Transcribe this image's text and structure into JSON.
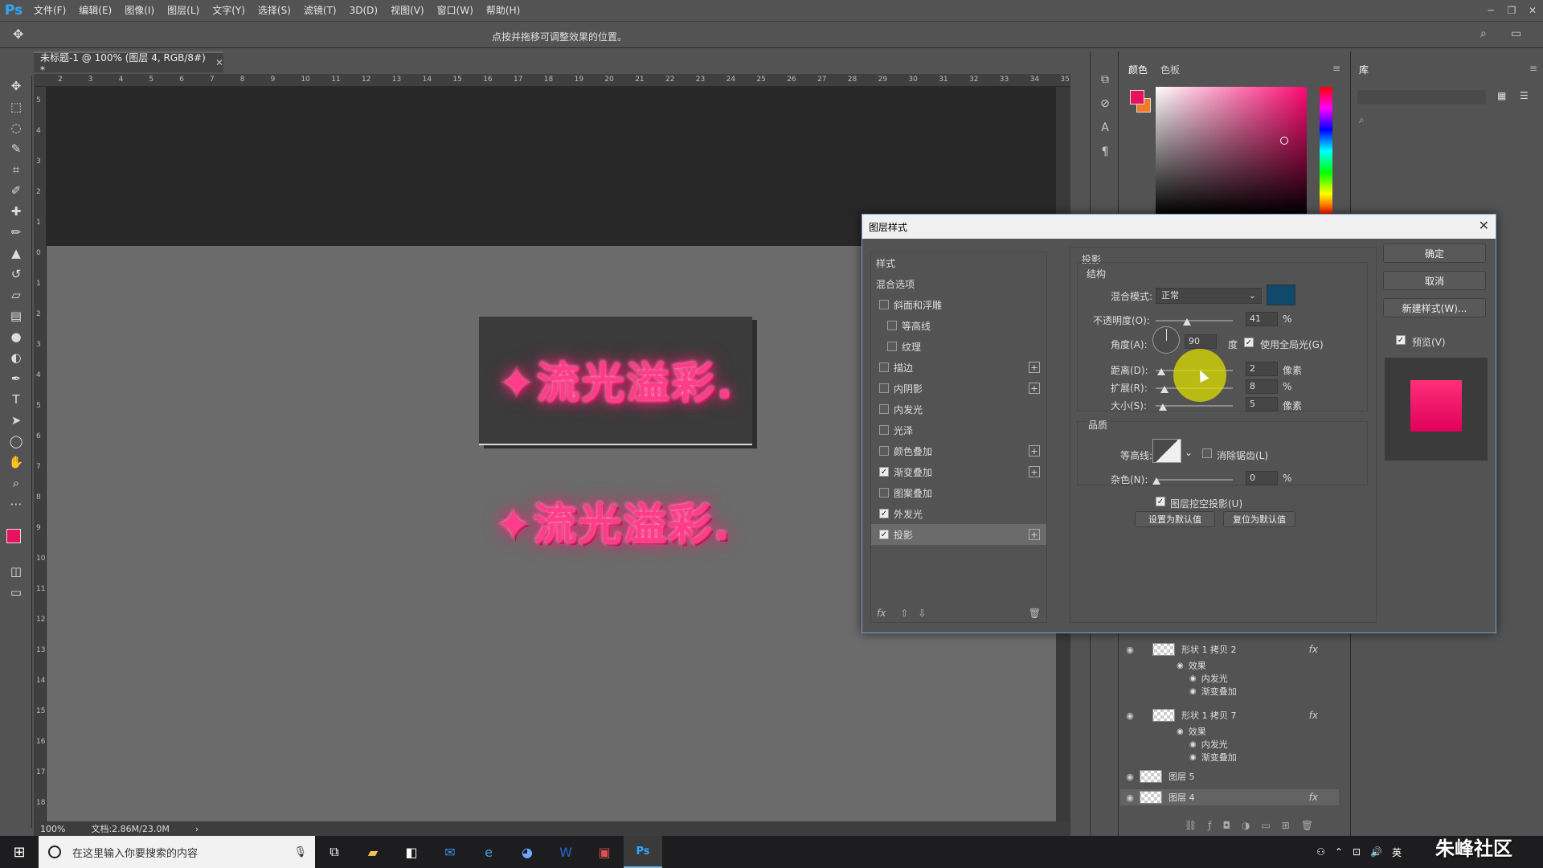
{
  "app": {
    "logo": "Ps"
  },
  "menu": [
    "文件(F)",
    "编辑(E)",
    "图像(I)",
    "图层(L)",
    "文字(Y)",
    "选择(S)",
    "滤镜(T)",
    "3D(D)",
    "视图(V)",
    "窗口(W)",
    "帮助(H)"
  ],
  "options_bar": {
    "hint": "点按并拖移可调整效果的位置。"
  },
  "document": {
    "tab_title": "未标题-1 @ 100% (图层 4, RGB/8#) *",
    "zoom": "100%",
    "doc_info": "文档:2.86M/23.0M"
  },
  "ruler": {
    "h_labels": [
      "2",
      "3",
      "4",
      "5",
      "6",
      "7",
      "8",
      "9",
      "10",
      "11",
      "12",
      "13",
      "14",
      "15",
      "16",
      "17",
      "18",
      "19",
      "20",
      "21",
      "22",
      "23",
      "24",
      "25",
      "26",
      "27",
      "28",
      "29",
      "30",
      "31",
      "32",
      "33",
      "34",
      "35"
    ],
    "v_labels": [
      "5",
      "4",
      "3",
      "2",
      "1",
      "0",
      "1",
      "2",
      "3",
      "4",
      "5",
      "6",
      "7",
      "8",
      "9",
      "10",
      "11",
      "12",
      "13",
      "14",
      "15",
      "16",
      "17",
      "18"
    ]
  },
  "canvas": {
    "art_text": "✦流光溢彩."
  },
  "color_panel": {
    "tab_color": "颜色",
    "tab_swatches": "色板",
    "fg": "#e8115f",
    "bg": "#f07a2a"
  },
  "library": {
    "tab": "库"
  },
  "dialog": {
    "title": "图层样式",
    "styles_header": "样式",
    "items": [
      {
        "label": "混合选项",
        "checkbox": false,
        "checked": false,
        "plus": false
      },
      {
        "label": "斜面和浮雕",
        "checkbox": true,
        "checked": false,
        "plus": false
      },
      {
        "label": "等高线",
        "checkbox": true,
        "checked": false,
        "plus": false,
        "indent": true
      },
      {
        "label": "纹理",
        "checkbox": true,
        "checked": false,
        "plus": false,
        "indent": true
      },
      {
        "label": "描边",
        "checkbox": true,
        "checked": false,
        "plus": true
      },
      {
        "label": "内阴影",
        "checkbox": true,
        "checked": false,
        "plus": true
      },
      {
        "label": "内发光",
        "checkbox": true,
        "checked": false,
        "plus": false
      },
      {
        "label": "光泽",
        "checkbox": true,
        "checked": false,
        "plus": false
      },
      {
        "label": "颜色叠加",
        "checkbox": true,
        "checked": false,
        "plus": true
      },
      {
        "label": "渐变叠加",
        "checkbox": true,
        "checked": true,
        "plus": true
      },
      {
        "label": "图案叠加",
        "checkbox": true,
        "checked": false,
        "plus": false
      },
      {
        "label": "外发光",
        "checkbox": true,
        "checked": true,
        "plus": false
      },
      {
        "label": "投影",
        "checkbox": true,
        "checked": true,
        "plus": true,
        "selected": true
      }
    ],
    "section_title": "投影",
    "structure": {
      "title": "结构",
      "blend_mode_label": "混合模式:",
      "blend_mode_value": "正常",
      "shadow_color": "#0f4a6a",
      "opacity_label": "不透明度(O):",
      "opacity_value": "41",
      "opacity_unit": "%",
      "angle_label": "角度(A):",
      "angle_value": "90",
      "angle_unit": "度",
      "global_light_label": "使用全局光(G)",
      "distance_label": "距离(D):",
      "distance_value": "2",
      "distance_unit": "像素",
      "spread_label": "扩展(R):",
      "spread_value": "8",
      "spread_unit": "%",
      "size_label": "大小(S):",
      "size_value": "5",
      "size_unit": "像素"
    },
    "quality": {
      "title": "品质",
      "contour_label": "等高线:",
      "antialias_label": "消除锯齿(L)",
      "noise_label": "杂色(N):",
      "noise_value": "0",
      "noise_unit": "%"
    },
    "knockout_label": "图层挖空投影(U)",
    "set_default": "设置为默认值",
    "reset_default": "复位为默认值",
    "ok": "确定",
    "cancel": "取消",
    "new_style": "新建样式(W)...",
    "preview_label": "预览(V)"
  },
  "layers": [
    {
      "name": "形状 1 拷贝 2",
      "fx": "fx",
      "effects_label": "效果",
      "effects": [
        "内发光",
        "渐变叠加"
      ]
    },
    {
      "name": "形状 1 拷贝 7",
      "fx": "fx",
      "effects_label": "效果",
      "effects": [
        "内发光",
        "渐变叠加"
      ]
    },
    {
      "name": "图层 5"
    },
    {
      "name": "图层 4",
      "fx": "fx"
    }
  ],
  "taskbar": {
    "search_placeholder": "在这里输入你要搜索的内容",
    "ime": "英"
  },
  "watermark": "朱峰社区"
}
